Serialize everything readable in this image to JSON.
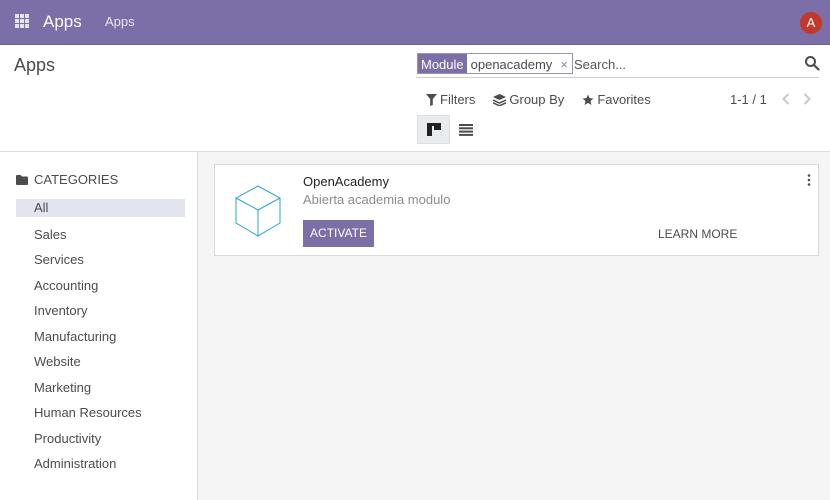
{
  "navbar": {
    "brand": "Apps",
    "menu_items": [
      {
        "label": "Apps"
      }
    ],
    "user_initial": "A",
    "avatar_color": "#c0392b",
    "bar_color": "#7c6ea6"
  },
  "control_panel": {
    "title": "Apps",
    "search": {
      "facet_label": "Module",
      "facet_value": "openacademy",
      "facet_remove": "×",
      "placeholder": "Search..."
    },
    "filters": {
      "filters_label": "Filters",
      "group_by_label": "Group By",
      "favorites_label": "Favorites"
    },
    "pager": "1-1 / 1",
    "views": [
      "kanban-view-icon",
      "list-view-icon"
    ]
  },
  "sidebar": {
    "header": "CATEGORIES",
    "categories": [
      {
        "label": "All",
        "active": true
      },
      {
        "label": "Sales"
      },
      {
        "label": "Services"
      },
      {
        "label": "Accounting"
      },
      {
        "label": "Inventory"
      },
      {
        "label": "Manufacturing"
      },
      {
        "label": "Website"
      },
      {
        "label": "Marketing"
      },
      {
        "label": "Human Resources"
      },
      {
        "label": "Productivity"
      },
      {
        "label": "Administration"
      }
    ]
  },
  "modules": [
    {
      "name": "OpenAcademy",
      "summary": "Abierta academia modulo",
      "activate_label": "ACTIVATE",
      "learn_more_label": "LEARN MORE",
      "icon": "cube-icon"
    }
  ]
}
